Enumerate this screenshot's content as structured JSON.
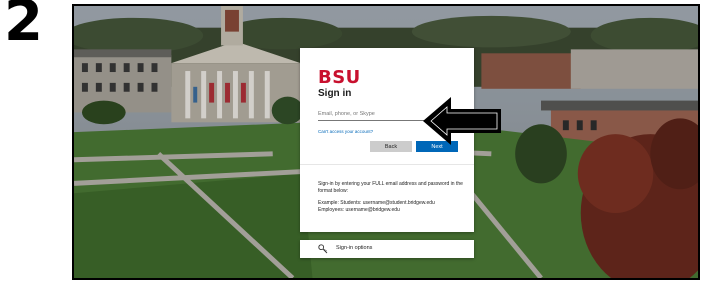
{
  "step": {
    "number": "2"
  },
  "signin": {
    "logo": "BSU",
    "title": "Sign in",
    "input_placeholder": "Email, phone, or Skype",
    "cant_access": "Can't access your account?",
    "back_label": "Back",
    "next_label": "Next",
    "info_line1": "Sign-in by entering your FULL email address and password in the format below:",
    "info_example": "Example: Students: username@student.bridgew.edu",
    "info_employees": "Employees: username@bridgew.edu"
  },
  "options": {
    "label": "Sign-in options",
    "icon": "key-icon"
  },
  "annotation": {
    "icon": "left-arrow-icon"
  },
  "colors": {
    "brand_red": "#c8102e",
    "accent_blue": "#0067b8",
    "button_grey": "#cccccc"
  }
}
